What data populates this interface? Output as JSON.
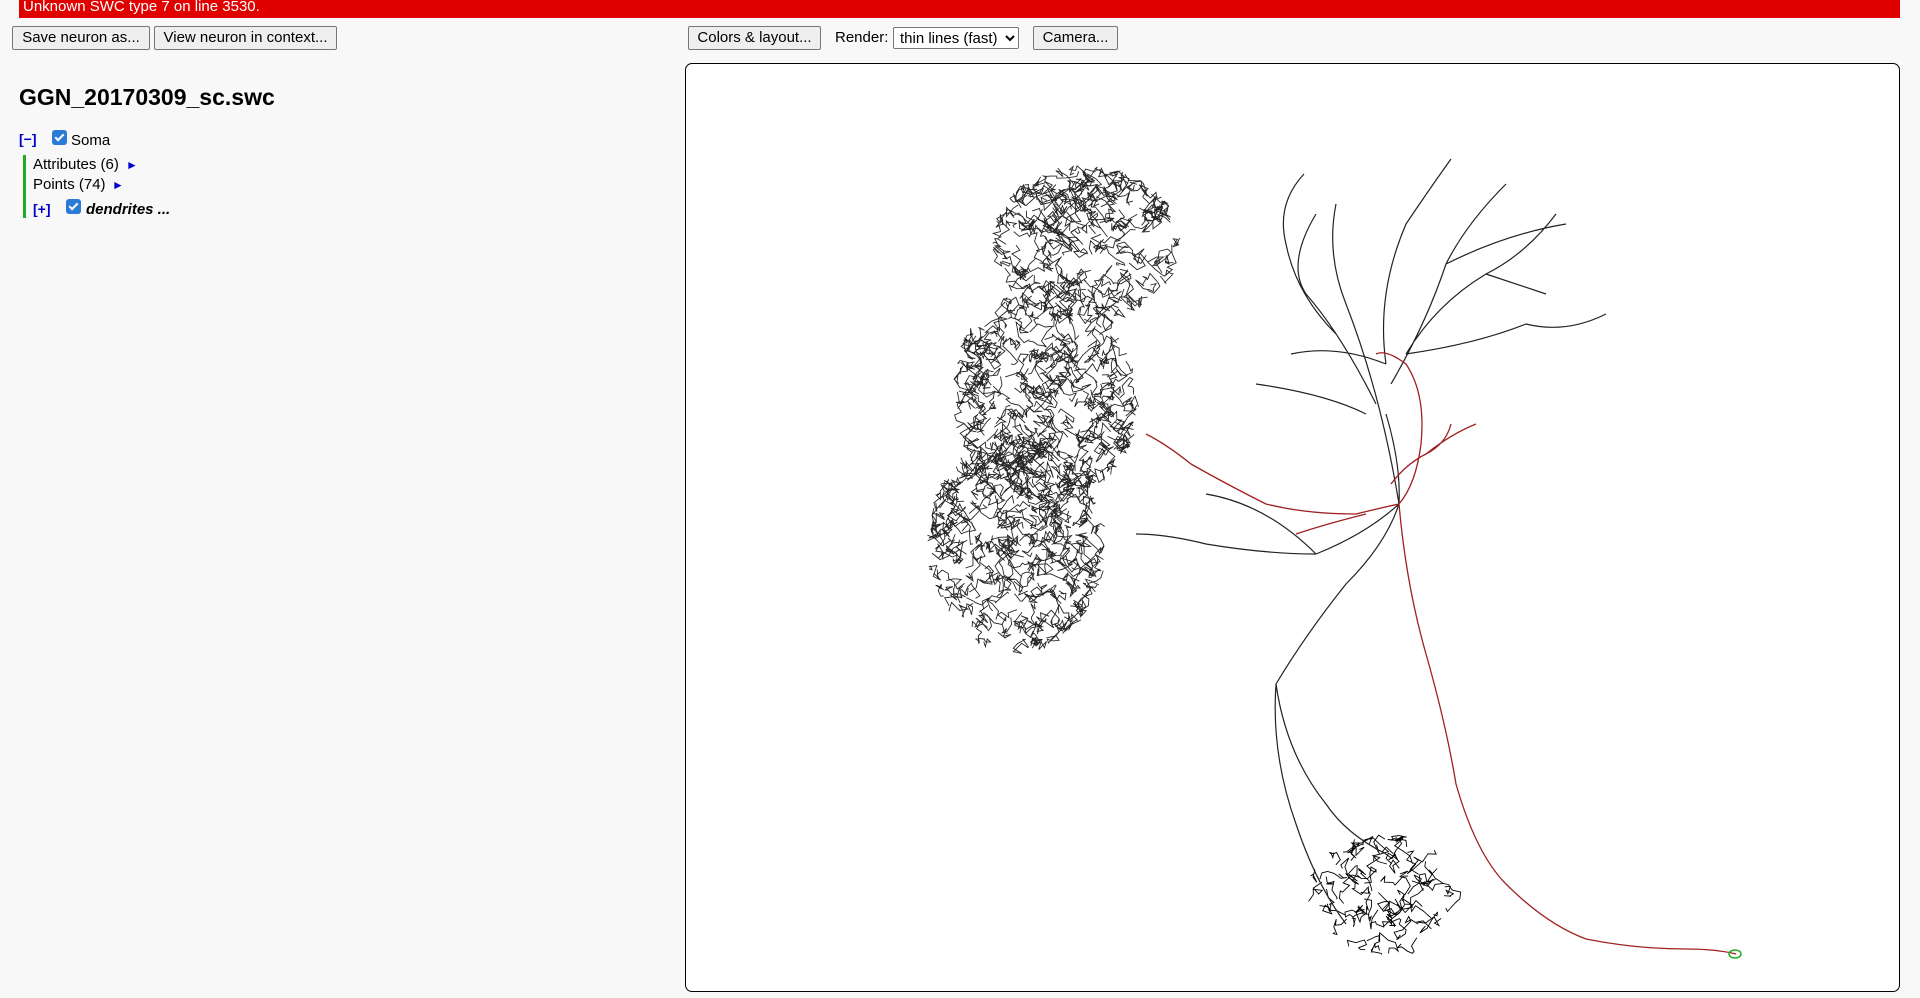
{
  "error": {
    "message": "Unknown SWC type 7 on line 3530."
  },
  "toolbar": {
    "save_label": "Save neuron as...",
    "context_label": "View neuron in context...",
    "colors_label": "Colors & layout...",
    "render_label": "Render:",
    "render_value": "thin lines (fast)",
    "camera_label": "Camera..."
  },
  "tree": {
    "file_name": "GGN_20170309_sc.swc",
    "soma": {
      "toggle": "[−]",
      "label": "Soma",
      "checked": true,
      "attributes": "Attributes (6)",
      "points": "Points (74)",
      "arrow": "►"
    },
    "dendrites": {
      "toggle": "[+]",
      "label": "dendrites ...",
      "checked": true
    }
  },
  "viewer": {
    "colors": {
      "dendrite": "#000000",
      "axon": "#a02020",
      "soma": "#22aa22",
      "border": "#000000"
    }
  },
  "colors": {
    "error_bg": "#e00000",
    "link": "#0000cc",
    "tree_line": "#22aa22",
    "checkbox": "#2b7bd6"
  }
}
